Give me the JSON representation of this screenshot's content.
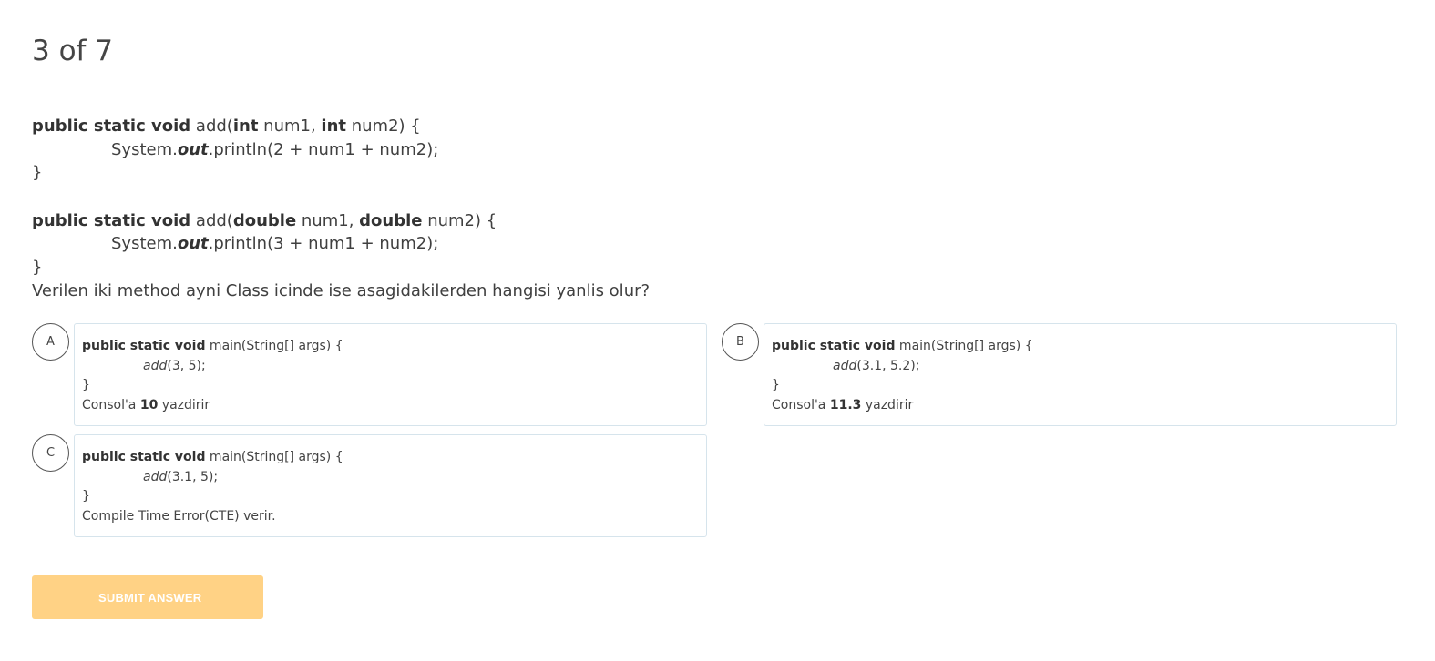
{
  "progress": "3 of 7",
  "question": {
    "m1_sig_kw1": "public static void",
    "m1_sig_name": " add(",
    "m1_sig_kw2": "int",
    "m1_sig_p1": " num1, ",
    "m1_sig_kw3": "int",
    "m1_sig_p2": " num2) {",
    "m1_body_pre": "System.",
    "m1_body_out": "out",
    "m1_body_post": ".println(2 + num1 + num2);",
    "m1_close": "}",
    "m2_sig_kw1": "public static void",
    "m2_sig_name": " add(",
    "m2_sig_kw2": "double",
    "m2_sig_p1": " num1, ",
    "m2_sig_kw3": "double",
    "m2_sig_p2": " num2) {",
    "m2_body_pre": "System.",
    "m2_body_out": "out",
    "m2_body_post": ".println(3 + num1 + num2);",
    "m2_close": "}",
    "prompt": "Verilen iki method ayni Class icinde ise asagidakilerden hangisi yanlis olur?"
  },
  "options": [
    {
      "letter": "A",
      "sig_kw": "public static void",
      "sig_rest": " main(String[] args) {",
      "call_name": "add",
      "call_args": "(3, 5);",
      "close": "}",
      "result_pre": "Consol'a ",
      "result_bold": "10",
      "result_post": " yazdirir"
    },
    {
      "letter": "B",
      "sig_kw": "public static void",
      "sig_rest": " main(String[] args) {",
      "call_name": "add",
      "call_args": "(3.1, 5.2);",
      "close": "}",
      "result_pre": "Consol'a ",
      "result_bold": "11.3",
      "result_post": " yazdirir"
    },
    {
      "letter": "C",
      "sig_kw": "public static void",
      "sig_rest": " main(String[] args) {",
      "call_name": "add",
      "call_args": "(3.1, 5);",
      "close": "}",
      "result_pre": "Compile Time Error(CTE) verir.",
      "result_bold": "",
      "result_post": ""
    }
  ],
  "submit_label": "SUBMIT ANSWER",
  "colors": {
    "submit_bg": "#ffd285",
    "card_border": "#d6e4ec",
    "text": "#404040"
  }
}
